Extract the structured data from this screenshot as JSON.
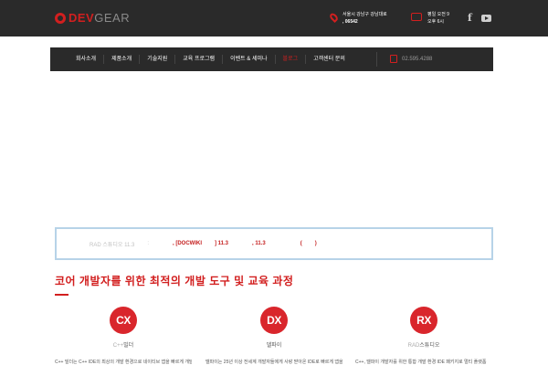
{
  "header": {
    "logo": {
      "brand_dev": "DEV",
      "brand_gear": "GEAR"
    },
    "contact": {
      "line1": "서울시 강남구 강남대로",
      "zip": ", 06542"
    },
    "hours": {
      "line1": "평일 오전 9",
      "line2": "오후 6시"
    },
    "social": {
      "facebook": "f",
      "youtube": "youtube"
    }
  },
  "nav": {
    "items": [
      {
        "label": "회사소개",
        "active": false
      },
      {
        "label": "제품소개",
        "active": false
      },
      {
        "label": "기술지원",
        "active": false
      },
      {
        "label": "교육 프로그램",
        "active": false
      },
      {
        "label": "이벤트 & 세미나",
        "active": false
      },
      {
        "label": "블로그",
        "active": true
      },
      {
        "label": "고객센터 문의",
        "active": false
      }
    ],
    "phone": "02.595.4288"
  },
  "notice": {
    "label": "RAD 스튜디오 11.3",
    "sep": ":",
    "link1": ", [DOCWIKI",
    "link2": "] 11.3",
    "link3": ", 11.3",
    "link4": "(",
    "link5": ")"
  },
  "section": {
    "title": "코어 개발자를 위한 최적의 개발 도구 및 교육 과정"
  },
  "products": [
    {
      "badge": "CX",
      "name_prefix": "C++",
      "name": "빌더",
      "desc": "C++ 빌더는 C++ IDE의 최상의 개발 환경으로 네이티브 앱을 빠르게 개발"
    },
    {
      "badge": "DX",
      "name_prefix": "",
      "name": "델파이",
      "desc": "델파이는 25년 이상 전세계 개발자들에게 사랑 받아온 IDE로 빠르게 앱을 개발"
    },
    {
      "badge": "RX",
      "name_prefix": "RAD",
      "name": "스튜디오",
      "desc": "C++, 델파이 개발자를 위한 통합 개발 환경 IDE 패키지로 멀티 플랫폼"
    }
  ],
  "colors": {
    "brand": "#d21f1f",
    "dark": "#2a2a2a",
    "notice_border": "#b7d3e8"
  }
}
